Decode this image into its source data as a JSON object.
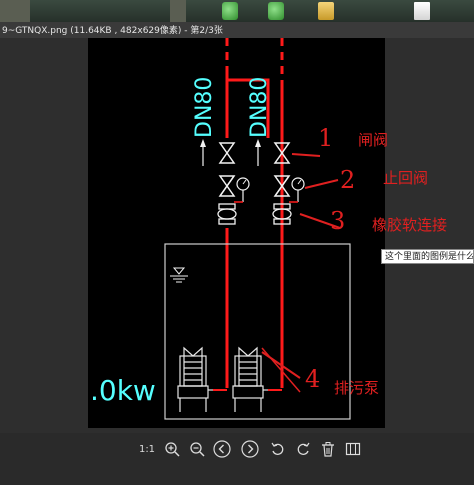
{
  "window": {
    "title": "9~GTNQX.png (11.64KB , 482x629像素) - 第2/3张"
  },
  "taskbar": {
    "icons": [
      "thumbnail",
      "green-app-icon",
      "green-app-icon",
      "folder-icon",
      "document-icon"
    ]
  },
  "drawing": {
    "pipe_label_left": "DN80",
    "pipe_label_right": "DN80",
    "power_label": ".0kw"
  },
  "annotations": [
    {
      "number": "1",
      "text": "闸阀"
    },
    {
      "number": "2",
      "text": "止回阀"
    },
    {
      "number": "3",
      "text": "橡胶软连接"
    },
    {
      "number": "4",
      "text": "排污泵"
    }
  ],
  "tooltip": {
    "text": "这个里面的图例是什么意"
  },
  "toolbar": {
    "actual_size_label": "1:1",
    "buttons": [
      "actual-size",
      "zoom-in",
      "zoom-out",
      "previous",
      "next",
      "rotate-left",
      "rotate-right",
      "delete",
      "gallery"
    ]
  },
  "colors": {
    "cad_background": "#000000",
    "pipe_red": "#ff1a1a",
    "annotation_red": "#e02020",
    "dn_label_cyan": "#55ffff",
    "valve_white": "#f2f2f2",
    "tank_outline": "#cfcfcf",
    "power_text_cyan": "#55ffff"
  }
}
